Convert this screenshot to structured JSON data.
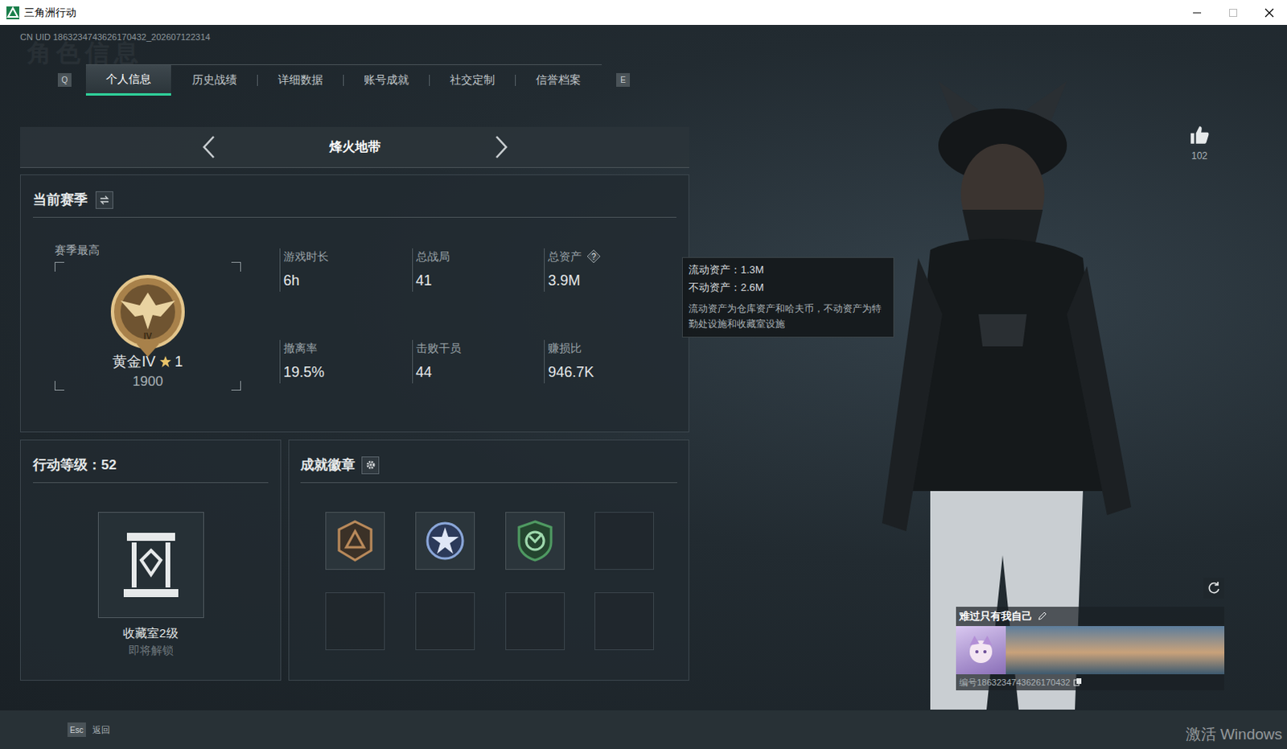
{
  "window": {
    "title": "三角洲行动"
  },
  "uid": "CN UID 1863234743626170432_202607122314",
  "watermark": "角色信息",
  "tabs": {
    "prev_key": "Q",
    "next_key": "E",
    "items": [
      {
        "label": "个人信息",
        "selected": true
      },
      {
        "label": "历史战绩",
        "selected": false
      },
      {
        "label": "详细数据",
        "selected": false
      },
      {
        "label": "账号成就",
        "selected": false
      },
      {
        "label": "社交定制",
        "selected": false
      },
      {
        "label": "信誉档案",
        "selected": false
      }
    ]
  },
  "mode": {
    "label": "烽火地带"
  },
  "season": {
    "title": "当前赛季",
    "best_label": "赛季最高",
    "badge_numeral": "IV",
    "rank": "黄金IV",
    "stars": "1",
    "score": "1900",
    "stats": [
      {
        "label": "游戏时长",
        "value": "6h",
        "has_help": false
      },
      {
        "label": "总战局",
        "value": "41",
        "has_help": false
      },
      {
        "label": "总资产",
        "value": "3.9M",
        "has_help": true
      },
      {
        "label": "撤离率",
        "value": "19.5%",
        "has_help": false
      },
      {
        "label": "击败干员",
        "value": "44",
        "has_help": false
      },
      {
        "label": "赚损比",
        "value": "946.7K",
        "has_help": false
      }
    ]
  },
  "tooltip": {
    "lines": [
      "流动资产：1.3M",
      "不动资产：2.6M"
    ],
    "description": "流动资产为仓库资产和哈夫币，不动资产为特勤处设施和收藏室设施"
  },
  "level": {
    "title": "行动等级：52",
    "item": "收藏室2级",
    "status": "即将解锁",
    "status_disabled": true
  },
  "badges": {
    "title": "成就徽章",
    "slots": [
      {
        "filled": true,
        "color": "#b8895a"
      },
      {
        "filled": true,
        "color": "#8aa6d8"
      },
      {
        "filled": true,
        "color": "#4f9a62"
      },
      {
        "filled": false,
        "color": "#3a444b"
      },
      {
        "filled": false,
        "color": "#3a444b"
      },
      {
        "filled": false,
        "color": "#3a444b"
      },
      {
        "filled": false,
        "color": "#3a444b"
      },
      {
        "filled": false,
        "color": "#3a444b"
      }
    ]
  },
  "profile": {
    "likes": "102",
    "name": "难过只有我自己",
    "id": "编号1863234743626170432"
  },
  "footer": {
    "key": "Esc",
    "label": "返回"
  },
  "activation": "激活 Windows"
}
